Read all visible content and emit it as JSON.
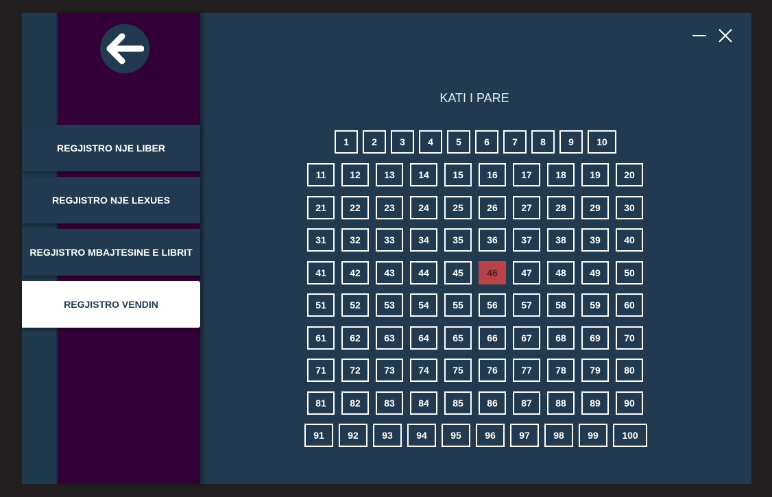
{
  "sidebar": {
    "back_icon": "arrow-left-icon",
    "nav_items": [
      {
        "label": "REGJISTRO NJE LIBER",
        "active": false
      },
      {
        "label": "REGJISTRO NJE LEXUES",
        "active": false
      },
      {
        "label": "REGJISTRO MBAJTESINE E LIBRIT",
        "active": false
      },
      {
        "label": "REGJISTRO VENDIN",
        "active": true
      }
    ]
  },
  "window_controls": {
    "minimize_icon": "minimize-icon",
    "close_icon": "close-icon"
  },
  "main": {
    "title": "KATI I PARE",
    "seats_count": 100,
    "selected_seat": 46
  },
  "colors": {
    "background": "#223a4f",
    "sidebar_purple": "#33003a",
    "seat_taken": "#b7434a",
    "seat_border": "#ffffff"
  }
}
